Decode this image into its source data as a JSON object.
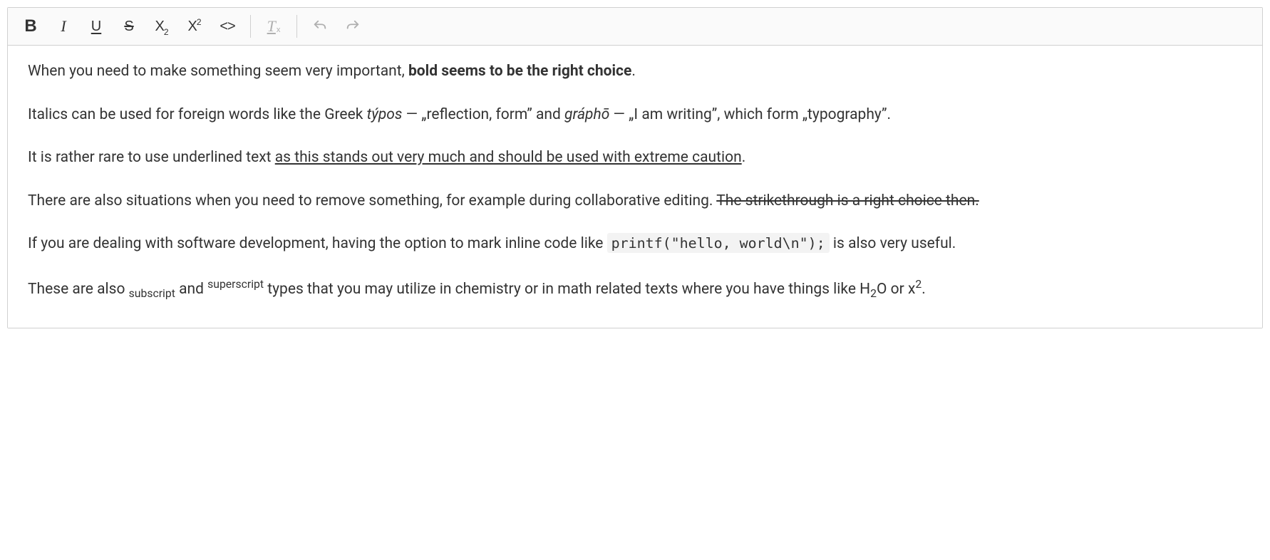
{
  "toolbar": {
    "bold_letter": "B",
    "italic_letter": "I",
    "underline_letter": "U",
    "strike_letter": "S",
    "subscript_base": "X",
    "subscript_index": "2",
    "superscript_base": "X",
    "superscript_index": "2",
    "code_glyph": "<>",
    "clear_base": "T",
    "clear_x": "x"
  },
  "content": {
    "p1_a": "When you need to make something seem very important, ",
    "p1_bold": "bold seems to be the right choice",
    "p1_b": ".",
    "p2_a": "Italics can be used for foreign words like the Greek ",
    "p2_i1": "týpos",
    "p2_b": " — „reflection, form” and ",
    "p2_i2": "gráphō",
    "p2_c": " — „I am writing”, which form „typography”.",
    "p3_a": "It is rather rare to use underlined text ",
    "p3_u": "as this stands out very much and should be used with extreme caution",
    "p3_b": ".",
    "p4_a": "There are also situations when you need to remove something, for example during collaborative editing. ",
    "p4_s": "The strikethrough is a right choice then.",
    "p5_a": "If you are dealing with software development, having the option to mark inline code like ",
    "p5_code": "printf(\"hello, world\\n\");",
    "p5_b": " is also very useful.",
    "p6_a": "These are also ",
    "p6_sub": "subscript",
    "p6_b": " and ",
    "p6_sup": "superscript",
    "p6_c": " types that you may utilize in chemistry or in math related texts where you have things like H",
    "p6_h2o_sub": "2",
    "p6_d": "O or x",
    "p6_x2_sup": "2",
    "p6_e": "."
  }
}
